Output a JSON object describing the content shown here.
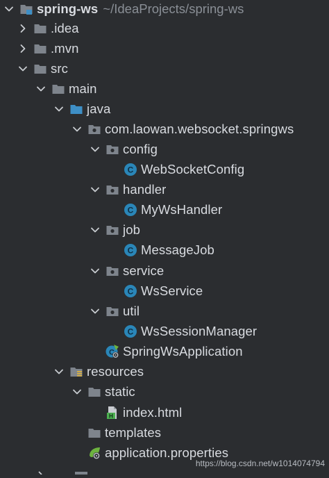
{
  "project": {
    "name": "spring-ws",
    "path": "~/IdeaProjects/spring-ws"
  },
  "tree": [
    {
      "label": "spring-ws"
    },
    {
      "label": ".idea"
    },
    {
      "label": ".mvn"
    },
    {
      "label": "src"
    },
    {
      "label": "main"
    },
    {
      "label": "java"
    },
    {
      "label": "com.laowan.websocket.springws"
    },
    {
      "label": "config"
    },
    {
      "label": "WebSocketConfig"
    },
    {
      "label": "handler"
    },
    {
      "label": "MyWsHandler"
    },
    {
      "label": "job"
    },
    {
      "label": "MessageJob"
    },
    {
      "label": "service"
    },
    {
      "label": "WsService"
    },
    {
      "label": "util"
    },
    {
      "label": "WsSessionManager"
    },
    {
      "label": "SpringWsApplication"
    },
    {
      "label": "resources"
    },
    {
      "label": "static"
    },
    {
      "label": "index.html"
    },
    {
      "label": "templates"
    },
    {
      "label": "application.properties"
    }
  ],
  "watermark": "https://blog.csdn.net/w1014074794",
  "colors": {
    "background": "#2b2d30",
    "text": "#d8dbe0",
    "path_text": "#8a8f96",
    "folder": "#7e848c",
    "source_folder": "#3e8fc6",
    "class_icon": "#2a86b8",
    "spring_green": "#6db33f"
  }
}
